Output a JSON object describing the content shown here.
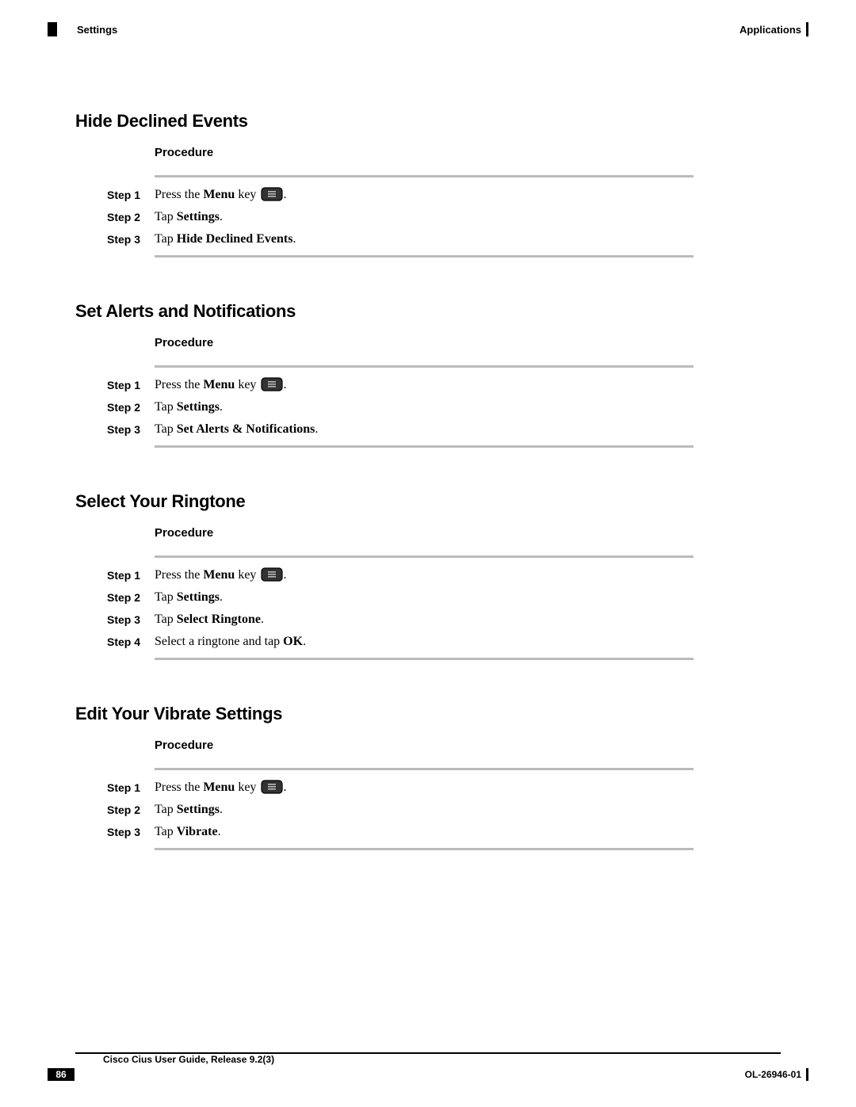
{
  "header": {
    "section": "Settings",
    "chapter": "Applications"
  },
  "sections": [
    {
      "title": "Hide Declined Events",
      "procedure_label": "Procedure",
      "steps": [
        {
          "label": "Step 1",
          "pre": "Press the ",
          "bold1": "Menu",
          "mid": " key ",
          "icon": true,
          "post": "."
        },
        {
          "label": "Step 2",
          "pre": "Tap ",
          "bold1": "Settings",
          "post": "."
        },
        {
          "label": "Step 3",
          "pre": "Tap ",
          "bold1": "Hide Declined Events",
          "post": "."
        }
      ]
    },
    {
      "title": "Set Alerts and Notifications",
      "procedure_label": "Procedure",
      "steps": [
        {
          "label": "Step 1",
          "pre": "Press the ",
          "bold1": "Menu",
          "mid": " key ",
          "icon": true,
          "post": "."
        },
        {
          "label": "Step 2",
          "pre": "Tap ",
          "bold1": "Settings",
          "post": "."
        },
        {
          "label": "Step 3",
          "pre": "Tap ",
          "bold1": "Set Alerts & Notifications",
          "post": "."
        }
      ]
    },
    {
      "title": "Select Your Ringtone",
      "procedure_label": "Procedure",
      "steps": [
        {
          "label": "Step 1",
          "pre": "Press the ",
          "bold1": "Menu",
          "mid": " key ",
          "icon": true,
          "post": "."
        },
        {
          "label": "Step 2",
          "pre": "Tap ",
          "bold1": "Settings",
          "post": "."
        },
        {
          "label": "Step 3",
          "pre": "Tap ",
          "bold1": "Select Ringtone",
          "post": "."
        },
        {
          "label": "Step 4",
          "pre": "Select a ringtone and tap ",
          "bold1": "OK",
          "post": "."
        }
      ]
    },
    {
      "title": "Edit Your Vibrate Settings",
      "procedure_label": "Procedure",
      "steps": [
        {
          "label": "Step 1",
          "pre": "Press the ",
          "bold1": "Menu",
          "mid": " key ",
          "icon": true,
          "post": "."
        },
        {
          "label": "Step 2",
          "pre": "Tap ",
          "bold1": "Settings",
          "post": "."
        },
        {
          "label": "Step 3",
          "pre": "Tap ",
          "bold1": "Vibrate",
          "post": "."
        }
      ]
    }
  ],
  "footer": {
    "title": "Cisco Cius User Guide, Release 9.2(3)",
    "page": "86",
    "docnum": "OL-26946-01"
  }
}
